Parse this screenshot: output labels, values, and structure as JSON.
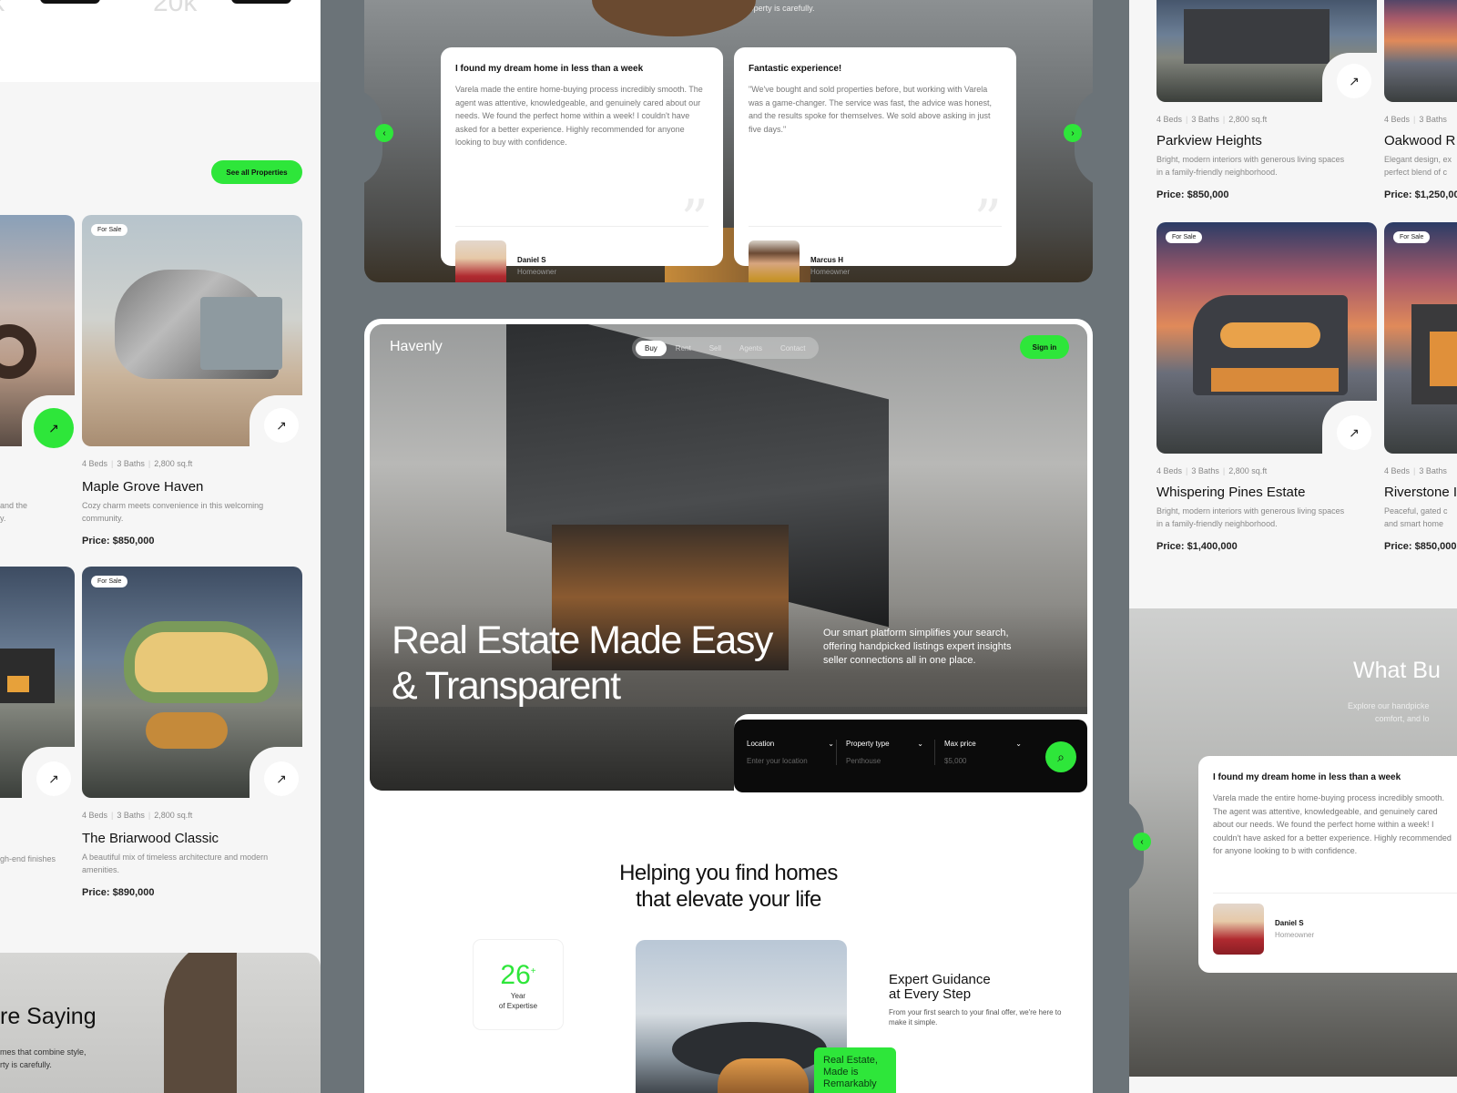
{
  "left": {
    "top_numbers": [
      "20k"
    ],
    "see_all_label": "See all Properties",
    "properties": [
      {
        "badge": "For Sale",
        "meta": [
          "4 Beds",
          "3 Baths",
          "2,800 sq.ft"
        ],
        "title": "Maple Grove Haven",
        "desc": "Cozy charm meets convenience in this welcoming community.",
        "price": "Price: $850,000"
      },
      {
        "badge": "For Sale",
        "meta": [
          "4 Beds",
          "3 Baths",
          "2,800 sq.ft"
        ],
        "title": "The Briarwood Classic",
        "desc": "A beautiful mix of timeless architecture and modern amenities.",
        "price": "Price: $890,000"
      }
    ],
    "partial_desc_1": [
      "and the",
      "y."
    ],
    "partial_desc_2": "gh-end finishes",
    "bottom_heading": "re Saying",
    "bottom_sub": [
      "mes that combine style,",
      "rty is carefully."
    ]
  },
  "center_top": {
    "intro": "comfort, and location Each property is carefully.",
    "testimonials": [
      {
        "title": "I found my dream home in less than a week",
        "text": "Varela made the entire home-buying process incredibly smooth. The agent was attentive, knowledgeable, and genuinely cared about our needs. We found the perfect home within a week! I couldn't have asked for a better experience. Highly recommended for anyone looking to buy with confidence.",
        "name": "Daniel S",
        "role": "Homeowner"
      },
      {
        "title": "Fantastic experience!",
        "text": "\"We've bought and sold properties before, but working with Varela was a game-changer. The service was fast, the advice was honest, and the results spoke for themselves. We sold above asking in just five days.\"",
        "name": "Marcus H",
        "role": "Homeowner"
      }
    ]
  },
  "hero": {
    "logo": "Havenly",
    "nav": [
      "Buy",
      "Rent",
      "Sell",
      "Agents",
      "Contact"
    ],
    "signin": "Sign in",
    "title_line1": "Real Estate Made Easy",
    "title_line2": "& Transparent",
    "subtitle": "Our smart platform simplifies your search, offering handpicked listings expert insights seller connections all in one place.",
    "search": {
      "location_label": "Location",
      "location_placeholder": "Enter your location",
      "type_label": "Property type",
      "type_value": "Penthouse",
      "price_label": "Max price",
      "price_value": "$5,000"
    },
    "section_title_line1": "Helping you find homes",
    "section_title_line2": "that elevate your life",
    "stat_number": "26",
    "stat_plus": "+",
    "stat_label_line1": "Year",
    "stat_label_line2": "of Expertise",
    "green_tag": "Real Estate, Made is Remarkably",
    "expert_title_line1": "Expert Guidance",
    "expert_title_line2": "at Every Step",
    "expert_desc": "From your first search to your final offer, we're here to make it simple."
  },
  "right": {
    "properties": [
      {
        "meta": [
          "4 Beds",
          "3 Baths",
          "2,800 sq.ft"
        ],
        "title": "Parkview Heights",
        "desc": "Bright, modern interiors with generous living spaces in a family-friendly neighborhood.",
        "price": "Price: $850,000"
      },
      {
        "meta": [
          "4 Beds",
          "3 Baths"
        ],
        "title": "Oakwood R",
        "desc": "Elegant design, ex perfect blend of c",
        "price": "Price: $1,250,00"
      },
      {
        "badge": "For Sale",
        "meta": [
          "4 Beds",
          "3 Baths",
          "2,800 sq.ft"
        ],
        "title": "Whispering Pines Estate",
        "desc": "Bright, modern interiors with generous living spaces in a family-friendly neighborhood.",
        "price": "Price: $1,400,000"
      },
      {
        "badge": "For Sale",
        "meta": [
          "4 Beds",
          "3 Baths"
        ],
        "title": "Riverstone I",
        "desc": "Peaceful, gated c and smart home",
        "price": "Price: $850,000"
      }
    ],
    "testimonial_heading": "What Bu",
    "testimonial_sub": [
      "Explore our handpicke",
      "comfort, and lo"
    ],
    "testimonial": {
      "title": "I found my dream home in less than a week",
      "text": "Varela made the entire home-buying process incredibly smooth. The agent was attentive, knowledgeable, and genuinely cared about our needs. We found the perfect home within a week! I couldn't have asked for a better experience. Highly recommended for anyone looking to b with confidence.",
      "name": "Daniel S",
      "role": "Homeowner"
    }
  },
  "colors": {
    "accent": "#2ee63a",
    "background": "#6b7378"
  },
  "icons": [
    "arrow-up-right-icon",
    "chevron-left-icon",
    "chevron-right-icon",
    "chevron-down-icon",
    "search-icon",
    "quote-icon"
  ]
}
